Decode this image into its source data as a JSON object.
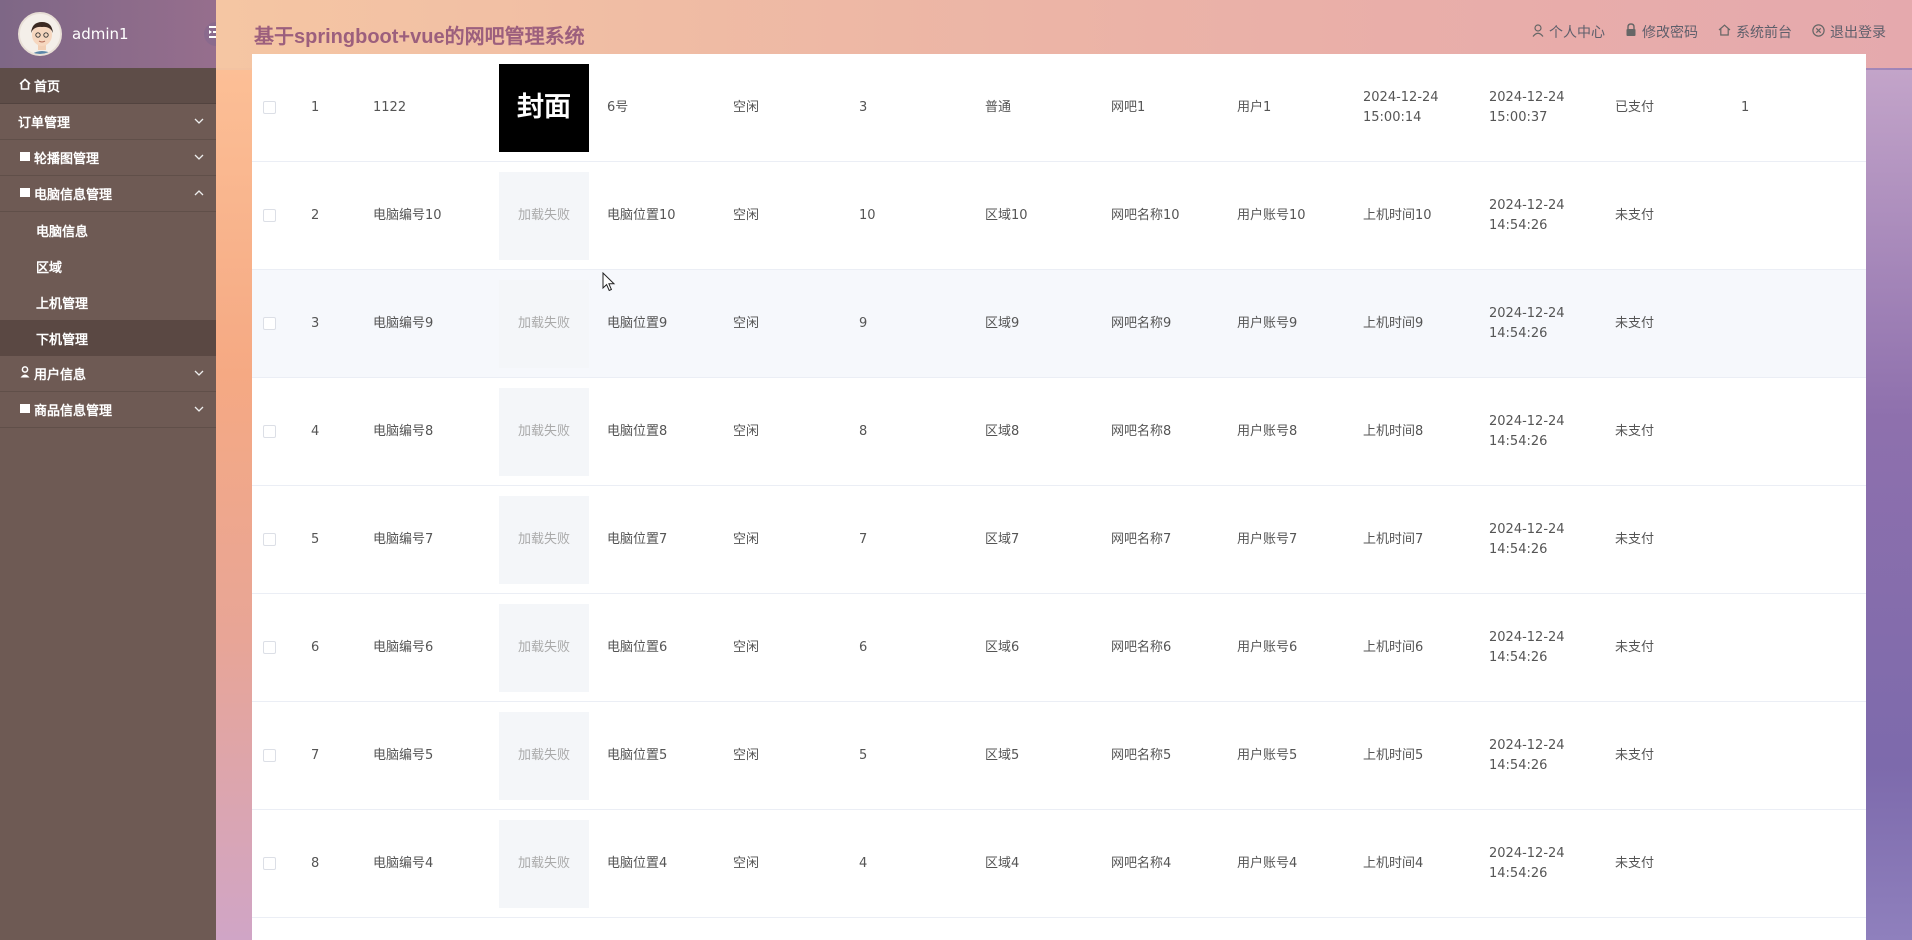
{
  "sidebar": {
    "username": "admin1",
    "menu": [
      {
        "label": "首页",
        "icon": "home-icon",
        "expanded": null
      },
      {
        "label": "订单管理",
        "icon": "",
        "expanded": false
      },
      {
        "label": "轮播图管理",
        "icon": "square-icon",
        "expanded": false
      },
      {
        "label": "电脑信息管理",
        "icon": "square-icon",
        "expanded": true,
        "children": [
          {
            "label": "电脑信息"
          },
          {
            "label": "区域"
          },
          {
            "label": "上机管理"
          },
          {
            "label": "下机管理",
            "active": true
          }
        ]
      },
      {
        "label": "用户信息",
        "icon": "user-icon",
        "expanded": false
      },
      {
        "label": "商品信息管理",
        "icon": "square-icon",
        "expanded": false
      }
    ]
  },
  "header": {
    "title": "基于springboot+vue的网吧管理系统",
    "links": [
      {
        "label": "个人中心",
        "icon": "user-icon"
      },
      {
        "label": "修改密码",
        "icon": "lock-icon"
      },
      {
        "label": "系统前台",
        "icon": "home-icon"
      },
      {
        "label": "退出登录",
        "icon": "close-circle-icon"
      }
    ]
  },
  "table": {
    "rows": [
      {
        "index": "1",
        "code": "1122",
        "cover": "封面",
        "cover_ok": true,
        "position": "6号",
        "status": "空闲",
        "num": "3",
        "area": "普通",
        "netbar": "网吧1",
        "user": "用户1",
        "start_time": "2024-12-24 15:00:14",
        "end_time": "2024-12-24 15:00:37",
        "pay": "已支付",
        "extra": "1"
      },
      {
        "index": "2",
        "code": "电脑编号10",
        "cover": "加载失败",
        "cover_ok": false,
        "position": "电脑位置10",
        "status": "空闲",
        "num": "10",
        "area": "区域10",
        "netbar": "网吧名称10",
        "user": "用户账号10",
        "start_time": "上机时间10",
        "end_time": "2024-12-24 14:54:26",
        "pay": "未支付",
        "extra": ""
      },
      {
        "index": "3",
        "code": "电脑编号9",
        "cover": "加载失败",
        "cover_ok": false,
        "position": "电脑位置9",
        "status": "空闲",
        "num": "9",
        "area": "区域9",
        "netbar": "网吧名称9",
        "user": "用户账号9",
        "start_time": "上机时间9",
        "end_time": "2024-12-24 14:54:26",
        "pay": "未支付",
        "extra": ""
      },
      {
        "index": "4",
        "code": "电脑编号8",
        "cover": "加载失败",
        "cover_ok": false,
        "position": "电脑位置8",
        "status": "空闲",
        "num": "8",
        "area": "区域8",
        "netbar": "网吧名称8",
        "user": "用户账号8",
        "start_time": "上机时间8",
        "end_time": "2024-12-24 14:54:26",
        "pay": "未支付",
        "extra": ""
      },
      {
        "index": "5",
        "code": "电脑编号7",
        "cover": "加载失败",
        "cover_ok": false,
        "position": "电脑位置7",
        "status": "空闲",
        "num": "7",
        "area": "区域7",
        "netbar": "网吧名称7",
        "user": "用户账号7",
        "start_time": "上机时间7",
        "end_time": "2024-12-24 14:54:26",
        "pay": "未支付",
        "extra": ""
      },
      {
        "index": "6",
        "code": "电脑编号6",
        "cover": "加载失败",
        "cover_ok": false,
        "position": "电脑位置6",
        "status": "空闲",
        "num": "6",
        "area": "区域6",
        "netbar": "网吧名称6",
        "user": "用户账号6",
        "start_time": "上机时间6",
        "end_time": "2024-12-24 14:54:26",
        "pay": "未支付",
        "extra": ""
      },
      {
        "index": "7",
        "code": "电脑编号5",
        "cover": "加载失败",
        "cover_ok": false,
        "position": "电脑位置5",
        "status": "空闲",
        "num": "5",
        "area": "区域5",
        "netbar": "网吧名称5",
        "user": "用户账号5",
        "start_time": "上机时间5",
        "end_time": "2024-12-24 14:54:26",
        "pay": "未支付",
        "extra": ""
      },
      {
        "index": "8",
        "code": "电脑编号4",
        "cover": "加载失败",
        "cover_ok": false,
        "position": "电脑位置4",
        "status": "空闲",
        "num": "4",
        "area": "区域4",
        "netbar": "网吧名称4",
        "user": "用户账号4",
        "start_time": "上机时间4",
        "end_time": "2024-12-24 14:54:26",
        "pay": "未支付",
        "extra": ""
      }
    ]
  }
}
